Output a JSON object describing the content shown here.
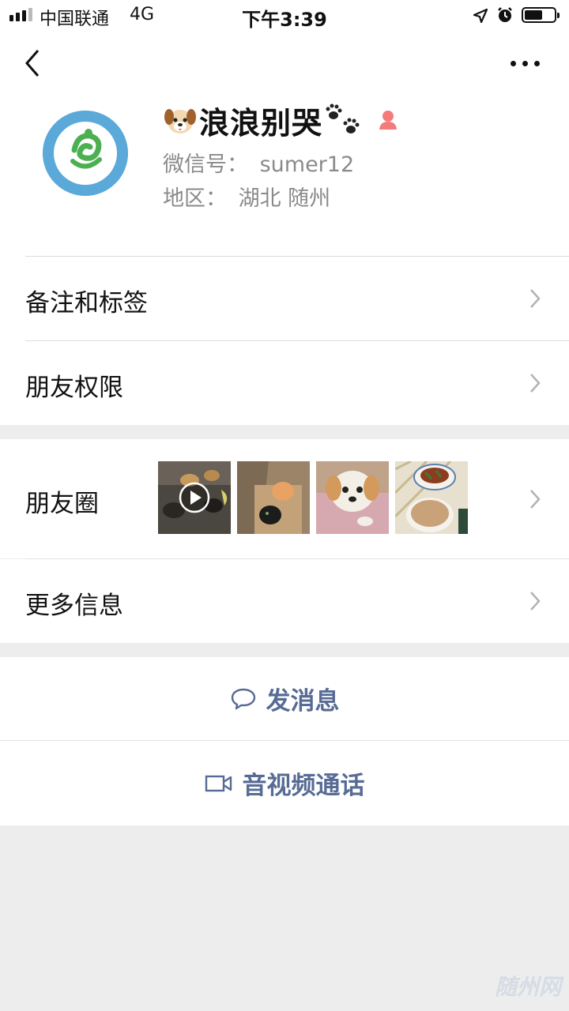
{
  "status_bar": {
    "carrier": "中国联通",
    "network": "4G",
    "time": "下午3:39",
    "battery_level": 0.55,
    "signal_bars": 3
  },
  "profile": {
    "name": "浪浪别哭",
    "wechat_id_label": "微信号：",
    "wechat_id": "sumer12",
    "region_label": "地区：",
    "region": "湖北 随州",
    "gender": "female"
  },
  "menu": {
    "remarks_tags": "备注和标签",
    "friend_permissions": "朋友权限",
    "moments": "朋友圈",
    "more_info": "更多信息"
  },
  "actions": {
    "send_message": "发消息",
    "video_call": "音视频通话"
  },
  "colors": {
    "link_blue": "#576b95",
    "background": "#ededed",
    "divider": "#dcdcdc",
    "gender_female": "#f37b7b"
  },
  "watermark": "随州网"
}
